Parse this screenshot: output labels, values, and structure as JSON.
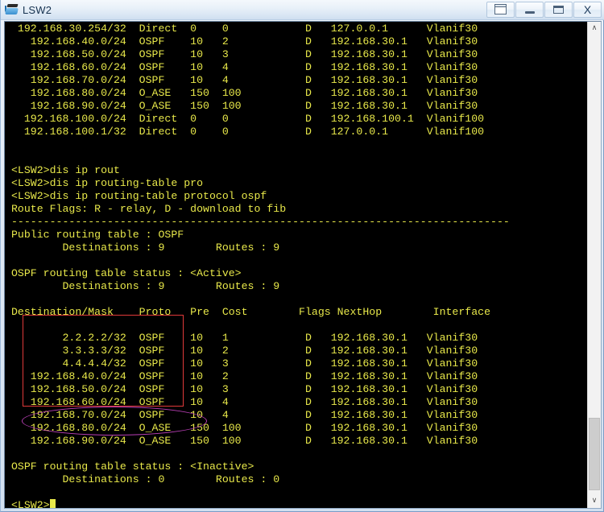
{
  "window": {
    "title": "LSW2",
    "icon": "switch-icon",
    "buttons": [
      {
        "name": "restore-windows-button",
        "label": "",
        "glyph": "restore-windows-icon"
      },
      {
        "name": "minimize-button",
        "label": "",
        "glyph": "minimize-icon"
      },
      {
        "name": "maximize-button",
        "label": "",
        "glyph": "maximize-icon"
      },
      {
        "name": "close-button",
        "label": "X",
        "glyph": "close-icon"
      }
    ]
  },
  "colors": {
    "terminal_background": "#000000",
    "terminal_text": "#e8e84a",
    "annotation_red": "#e03a3a",
    "annotation_purple": "#b93fb5",
    "chrome_blue": "#d2e0f0"
  },
  "terminal": {
    "prompt": "<LSW2>",
    "cursor_visible": true,
    "lines": [
      " 192.168.30.254/32  Direct  0    0            D   127.0.0.1      Vlanif30",
      "   192.168.40.0/24  OSPF    10   2            D   192.168.30.1   Vlanif30",
      "   192.168.50.0/24  OSPF    10   3            D   192.168.30.1   Vlanif30",
      "   192.168.60.0/24  OSPF    10   4            D   192.168.30.1   Vlanif30",
      "   192.168.70.0/24  OSPF    10   4            D   192.168.30.1   Vlanif30",
      "   192.168.80.0/24  O_ASE   150  100          D   192.168.30.1   Vlanif30",
      "   192.168.90.0/24  O_ASE   150  100          D   192.168.30.1   Vlanif30",
      "  192.168.100.0/24  Direct  0    0            D   192.168.100.1  Vlanif100",
      "  192.168.100.1/32  Direct  0    0            D   127.0.0.1      Vlanif100",
      "",
      "",
      "<LSW2>dis ip rout",
      "<LSW2>dis ip routing-table pro",
      "<LSW2>dis ip routing-table protocol ospf",
      "Route Flags: R - relay, D - download to fib",
      "------------------------------------------------------------------------------",
      "Public routing table : OSPF",
      "        Destinations : 9        Routes : 9",
      "",
      "OSPF routing table status : <Active>",
      "        Destinations : 9        Routes : 9",
      "",
      "Destination/Mask    Proto   Pre  Cost        Flags NextHop        Interface",
      "",
      "        2.2.2.2/32  OSPF    10   1            D   192.168.30.1   Vlanif30",
      "        3.3.3.3/32  OSPF    10   2            D   192.168.30.1   Vlanif30",
      "        4.4.4.4/32  OSPF    10   3            D   192.168.30.1   Vlanif30",
      "   192.168.40.0/24  OSPF    10   2            D   192.168.30.1   Vlanif30",
      "   192.168.50.0/24  OSPF    10   3            D   192.168.30.1   Vlanif30",
      "   192.168.60.0/24  OSPF    10   4            D   192.168.30.1   Vlanif30",
      "   192.168.70.0/24  OSPF    10   4            D   192.168.30.1   Vlanif30",
      "   192.168.80.0/24  O_ASE   150  100          D   192.168.30.1   Vlanif30",
      "   192.168.90.0/24  O_ASE   150  100          D   192.168.30.1   Vlanif30",
      "",
      "OSPF routing table status : <Inactive>",
      "        Destinations : 0        Routes : 0",
      "",
      "<LSW2>"
    ]
  },
  "annotations": {
    "red_box": {
      "name": "red-highlight-box",
      "covers": "OSPF intra/inter-area routes 2.2.2.2/32 through 192.168.70.0/24",
      "color": "#e03a3a"
    },
    "purple_ellipse": {
      "name": "purple-highlight-ellipse",
      "covers": "O_ASE external routes 192.168.80.0/24 and 192.168.90.0/24",
      "color": "#b93fb5"
    }
  },
  "scrollbar": {
    "up_arrow": "∧",
    "down_arrow": "∨",
    "thumb_position": "near-bottom"
  }
}
